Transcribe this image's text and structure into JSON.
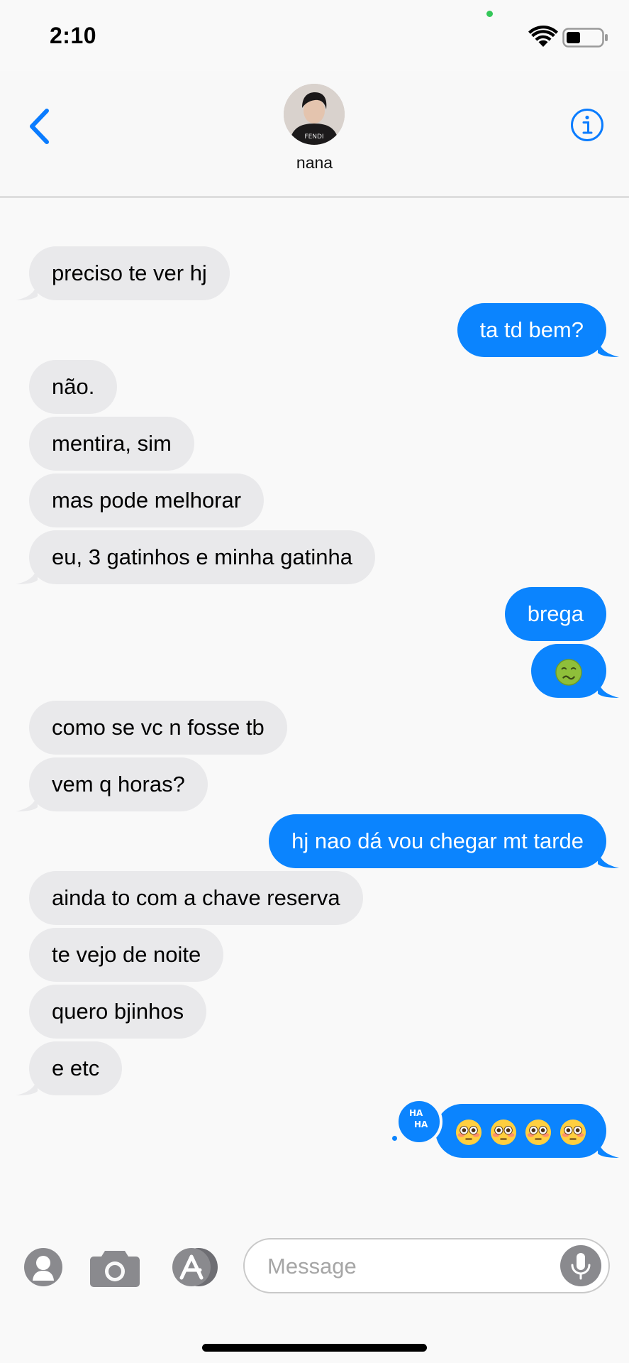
{
  "status_bar": {
    "time": "2:10",
    "battery_level": 0.4
  },
  "header": {
    "contact_name": "nana",
    "avatar_caption": "FENDI"
  },
  "messages": [
    {
      "id": 0,
      "side": "in",
      "text": "preciso te ver hj"
    },
    {
      "id": 1,
      "side": "out",
      "text": "ta td bem?"
    },
    {
      "id": 2,
      "side": "in",
      "text": "não."
    },
    {
      "id": 3,
      "side": "in",
      "text": "mentira, sim"
    },
    {
      "id": 4,
      "side": "in",
      "text": "mas pode melhorar"
    },
    {
      "id": 5,
      "side": "in",
      "text": "eu, 3 gatinhos e minha gatinha"
    },
    {
      "id": 6,
      "side": "out",
      "text": "brega"
    },
    {
      "id": 7,
      "side": "out",
      "emoji": [
        "nauseated-face"
      ]
    },
    {
      "id": 8,
      "side": "in",
      "text": "como se vc n fosse tb"
    },
    {
      "id": 9,
      "side": "in",
      "text": "vem q horas?"
    },
    {
      "id": 10,
      "side": "out",
      "text": "hj nao dá vou chegar mt tarde"
    },
    {
      "id": 11,
      "side": "in",
      "text": "ainda to com a chave reserva"
    },
    {
      "id": 12,
      "side": "in",
      "text": "te vejo de noite"
    },
    {
      "id": 13,
      "side": "in",
      "text": "quero bjinhos"
    },
    {
      "id": 14,
      "side": "in",
      "text": "e etc"
    },
    {
      "id": 15,
      "side": "out",
      "emoji": [
        "flushed-face",
        "flushed-face",
        "flushed-face",
        "flushed-face"
      ],
      "reaction": {
        "label_top": "HA",
        "label_bottom": "HA"
      }
    }
  ],
  "input_bar": {
    "placeholder": "Message"
  },
  "colors": {
    "outgoing": "#0b84fe",
    "incoming": "#e9e9eb",
    "accent": "#0a7cff"
  }
}
